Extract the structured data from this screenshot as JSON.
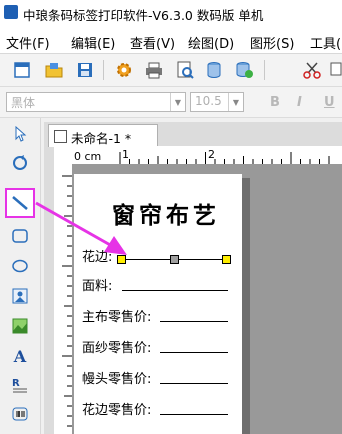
{
  "window": {
    "title": "中琅条码标签打印软件-V6.3.0 数码版 单机"
  },
  "menu": [
    {
      "label": "文件(F)"
    },
    {
      "label": "编辑(E)"
    },
    {
      "label": "查看(V)"
    },
    {
      "label": "绘图(D)"
    },
    {
      "label": "图形(S)"
    },
    {
      "label": "工具("
    }
  ],
  "toolbar": {
    "icons": [
      "new-document-icon",
      "open-folder-icon",
      "save-icon",
      "settings-gear-icon",
      "print-icon",
      "print-preview-icon",
      "database-icon",
      "database-settings-icon",
      "cut-icon",
      "copy-icon"
    ]
  },
  "fontbar": {
    "font_name": "黑体",
    "font_size": "10.5",
    "bold": "B",
    "italic": "I",
    "underline": "U"
  },
  "palette": {
    "tools": [
      "pointer-tool-icon",
      "rotate-tool-icon",
      "line-tool-icon",
      "rounded-rect-tool-icon",
      "ellipse-tool-icon",
      "image-tool-icon",
      "picture-tool-icon",
      "text-tool-icon",
      "rich-text-tool-icon",
      "barcode-tool-icon"
    ],
    "selected": "line-tool-icon",
    "highlight_color": "#e633e6"
  },
  "document": {
    "tab_title": "未命名-1 *",
    "ruler_labels": [
      "0 cm",
      "1",
      "2"
    ]
  },
  "label": {
    "title": "窗帘布艺",
    "fields": [
      {
        "label": "花边:"
      },
      {
        "label": "面料:"
      },
      {
        "label": "主布零售价:"
      },
      {
        "label": "面纱零售价:"
      },
      {
        "label": "幔头零售价:"
      },
      {
        "label": "花边零售价:"
      }
    ],
    "handle_colors": {
      "end": "#ffee00",
      "middle": "#a0a0a0"
    }
  }
}
